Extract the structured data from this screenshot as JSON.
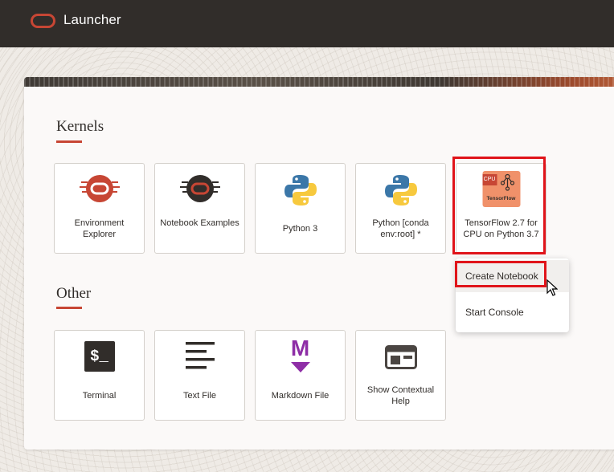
{
  "app": {
    "title": "Launcher"
  },
  "sections": {
    "kernels": {
      "title": "Kernels"
    },
    "other": {
      "title": "Other"
    }
  },
  "kernels": [
    {
      "label": "Environment Explorer",
      "icon": "environment-explorer-icon"
    },
    {
      "label": "Notebook Examples",
      "icon": "notebook-examples-icon"
    },
    {
      "label": "Python 3",
      "icon": "python-icon"
    },
    {
      "label": "Python [conda env:root] *",
      "icon": "python-icon"
    },
    {
      "label": "TensorFlow 2.7 for CPU on Python 3.7",
      "icon": "tensorflow-cpu-icon",
      "icon_badge": "CPU",
      "icon_text": "TensorFlow"
    }
  ],
  "other": [
    {
      "label": "Terminal",
      "icon": "terminal-icon",
      "glyph": "$_"
    },
    {
      "label": "Text File",
      "icon": "text-file-icon"
    },
    {
      "label": "Markdown File",
      "icon": "markdown-icon",
      "glyph": "M"
    },
    {
      "label": "Show Contextual Help",
      "icon": "contextual-help-icon"
    }
  ],
  "context_menu": {
    "create_notebook": "Create Notebook",
    "start_console": "Start Console"
  },
  "colors": {
    "accent": "#c74634",
    "topbar": "#312d2a",
    "highlight": "#e0141a"
  }
}
